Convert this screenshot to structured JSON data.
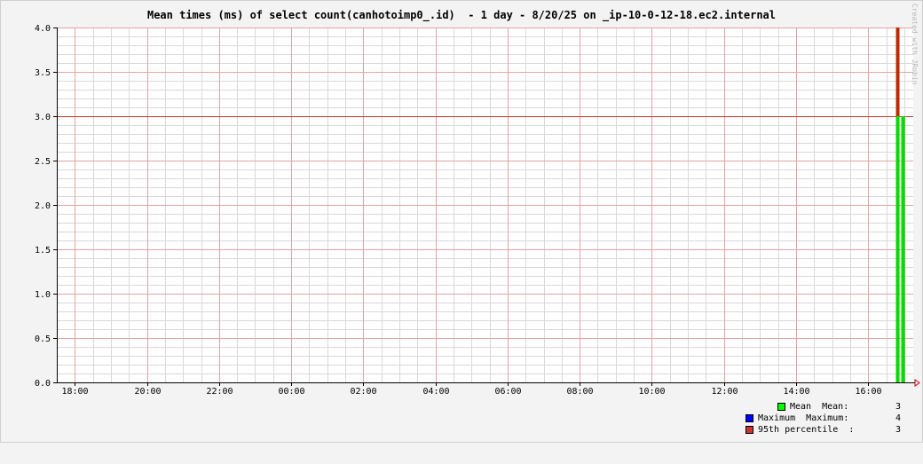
{
  "chart_data": {
    "type": "bar",
    "title": "Mean times (ms) of select count(canhotoimp0_.id)  - 1 day - 8/20/25 on _ip-10-0-12-18.ec2.internal",
    "watermark": "Created with JRobin",
    "ylim": [
      0,
      4
    ],
    "yticks": [
      "0.0",
      "0.5",
      "1.0",
      "1.5",
      "2.0",
      "2.5",
      "3.0",
      "3.5",
      "4.0"
    ],
    "xlim_hours": [
      17.5,
      41.25
    ],
    "xticks": [
      {
        "label": "18:00",
        "t": 18
      },
      {
        "label": "20:00",
        "t": 20
      },
      {
        "label": "22:00",
        "t": 22
      },
      {
        "label": "00:00",
        "t": 24
      },
      {
        "label": "02:00",
        "t": 26
      },
      {
        "label": "04:00",
        "t": 28
      },
      {
        "label": "06:00",
        "t": 30
      },
      {
        "label": "08:00",
        "t": 32
      },
      {
        "label": "10:00",
        "t": 34
      },
      {
        "label": "12:00",
        "t": 36
      },
      {
        "label": "14:00",
        "t": 38
      },
      {
        "label": "16:00",
        "t": 40
      }
    ],
    "series": [
      {
        "name": "Mean",
        "color": "#00ff00",
        "points": [
          {
            "t": 40.82,
            "v": 3
          },
          {
            "t": 40.97,
            "v": 3
          }
        ]
      },
      {
        "name": "Maximum",
        "color": "#0000ff",
        "points": [
          {
            "t": 40.82,
            "v": 4
          },
          {
            "t": 40.97,
            "v": 3
          }
        ]
      },
      {
        "name": "95th percentile",
        "color": "#ff0000",
        "points": [
          {
            "t": 40.82,
            "v": 3
          }
        ]
      }
    ]
  },
  "legend": [
    {
      "label": "Mean  Mean:",
      "value": "3",
      "color": "#00ff00"
    },
    {
      "label": "Maximum  Maximum:",
      "value": "4",
      "color": "#0000ff"
    },
    {
      "label": "95th percentile  :",
      "value": "3",
      "color": "#cc3333"
    }
  ]
}
